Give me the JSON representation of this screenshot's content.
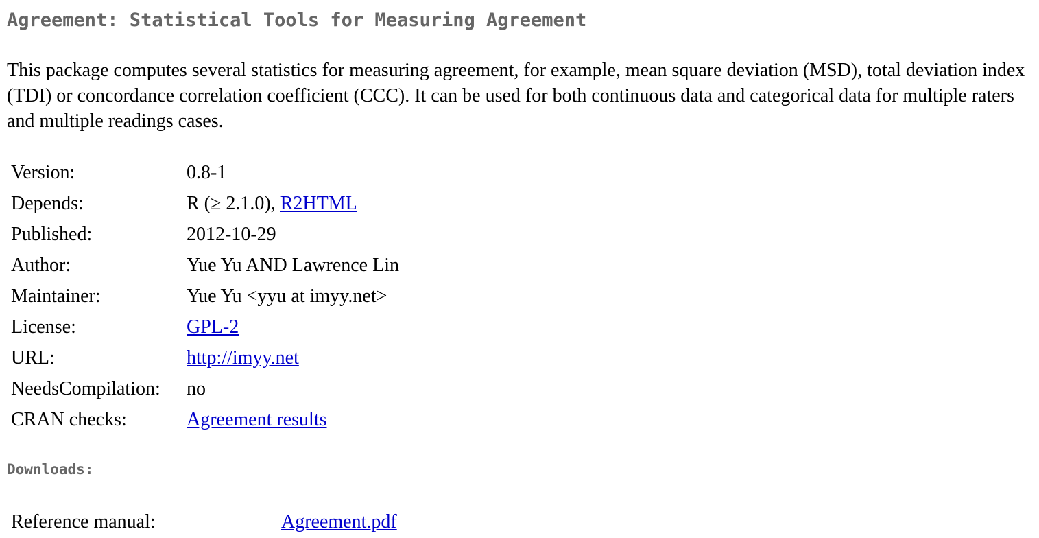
{
  "title": "Agreement: Statistical Tools for Measuring Agreement",
  "description": "This package computes several statistics for measuring agreement, for example, mean square deviation (MSD), total deviation index (TDI) or concordance correlation coefficient (CCC). It can be used for both continuous data and categorical data for multiple raters and multiple readings cases.",
  "meta": {
    "version": {
      "label": "Version:",
      "value": "0.8-1"
    },
    "depends": {
      "label": "Depends:",
      "value_text": "R (≥ 2.1.0), ",
      "link": "R2HTML"
    },
    "published": {
      "label": "Published:",
      "value": "2012-10-29"
    },
    "author": {
      "label": "Author:",
      "value": "Yue Yu AND Lawrence Lin"
    },
    "maintainer": {
      "label": "Maintainer:",
      "value": "Yue Yu <yyu at imyy.net>"
    },
    "license": {
      "label": "License:",
      "link": "GPL-2"
    },
    "url": {
      "label": "URL:",
      "link": "http://imyy.net"
    },
    "needs_compilation": {
      "label": "NeedsCompilation:",
      "value": "no"
    },
    "cran_checks": {
      "label": "CRAN checks:",
      "link": "Agreement results"
    }
  },
  "downloads": {
    "heading": "Downloads:",
    "reference_manual": {
      "label": "Reference manual:",
      "link": "Agreement.pdf"
    }
  },
  "colors": {
    "heading": "#666666",
    "link": "#0000cc",
    "text": "#000000"
  }
}
